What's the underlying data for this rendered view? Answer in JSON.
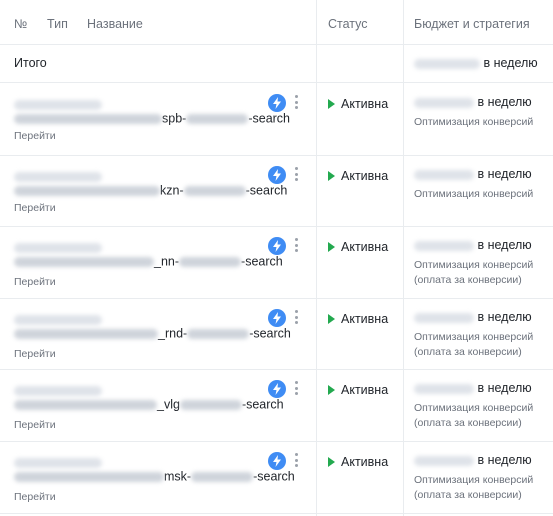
{
  "header": {
    "num": "№",
    "type": "Тип",
    "name": "Название",
    "status": "Статус",
    "budget": "Бюджет и стратегия"
  },
  "total": {
    "label": "Итого",
    "per_week": "в неделю"
  },
  "campaigns": [
    {
      "name_visible": "spb-",
      "name_suffix": "-search",
      "go": "Перейти",
      "status": "Активна",
      "per_week": "в неделю",
      "strategy1": "Оптимизация конверсий",
      "strategy2": ""
    },
    {
      "name_visible": "kzn-",
      "name_suffix": "-search",
      "go": "Перейти",
      "status": "Активна",
      "per_week": "в неделю",
      "strategy1": "Оптимизация конверсий",
      "strategy2": ""
    },
    {
      "name_visible": "_nn-",
      "name_suffix": "-search",
      "go": "Перейти",
      "status": "Активна",
      "per_week": "в неделю",
      "strategy1": "Оптимизация конверсий",
      "strategy2": "(оплата за конверсии)"
    },
    {
      "name_visible": "_rnd-",
      "name_suffix": "-search",
      "go": "Перейти",
      "status": "Активна",
      "per_week": "в неделю",
      "strategy1": "Оптимизация конверсий",
      "strategy2": "(оплата за конверсии)"
    },
    {
      "name_visible": "_vlg",
      "name_suffix": "-search",
      "go": "Перейти",
      "status": "Активна",
      "per_week": "в неделю",
      "strategy1": "Оптимизация конверсий",
      "strategy2": "(оплата за конверсии)"
    },
    {
      "name_visible": "msk-",
      "name_suffix": "-search",
      "go": "Перейти",
      "status": "Активна",
      "per_week": "в неделю",
      "strategy1": "Оптимизация конверсий",
      "strategy2": "(оплата за конверсии)"
    }
  ],
  "colors": {
    "accent": "#3f8cf4",
    "active": "#23a94f",
    "muted": "#6c727c",
    "border": "#e9ecef"
  },
  "icons": {
    "autotarget": "lightning-icon",
    "menu": "more-vertical-icon",
    "status": "play-triangle-icon"
  }
}
